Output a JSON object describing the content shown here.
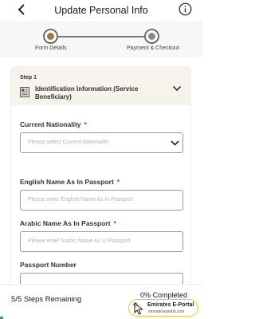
{
  "header": {
    "title": "Update Personal Info"
  },
  "stepper": {
    "steps": [
      {
        "label": "Form Details"
      },
      {
        "label": "Payment & Checkout"
      }
    ]
  },
  "step_card": {
    "step_number": "Step 1",
    "title": "Identification Information (Service Beneficiary)"
  },
  "fields": {
    "nationality": {
      "label": "Current Nationality",
      "required_mark": "*",
      "placeholder": "Please select Current Nationality"
    },
    "english_name": {
      "label": "English Name As In Passport",
      "required_mark": "*",
      "placeholder": "Please enter English Name As In Passport"
    },
    "arabic_name": {
      "label": "Arabic Name As In Passport",
      "required_mark": "*",
      "placeholder": "Please enter Arabic Name As In Passport"
    },
    "passport_number": {
      "label": "Passport Number"
    }
  },
  "footer": {
    "steps_remaining": "5/5 Steps Remaining",
    "completed": "0% Completed",
    "progress_percent": 0
  },
  "watermark": {
    "title": "Emirates E-Portal",
    "url": "emirateseportal.com"
  },
  "colors": {
    "accent": "#9c7b3d",
    "required": "#c0392b",
    "step_header_bg": "#f6f2ec",
    "stepper_bg": "#f7f7f7"
  }
}
